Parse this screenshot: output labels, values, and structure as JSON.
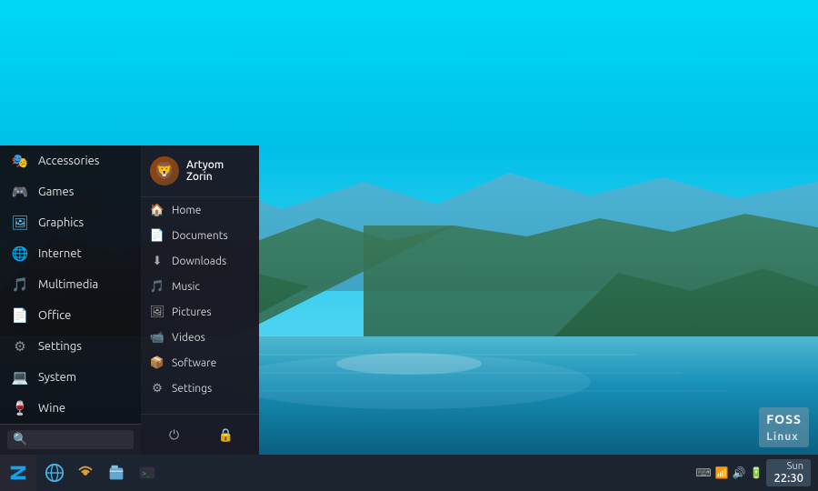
{
  "desktop": {
    "background_colors": [
      "#00d4f0",
      "#0090c0",
      "#1a6890"
    ]
  },
  "taskbar": {
    "clock": {
      "time": "22:30",
      "date": "Sun"
    },
    "icons": [
      {
        "name": "zorin-start",
        "label": "Start"
      },
      {
        "name": "browser-icon",
        "label": "Browser"
      },
      {
        "name": "network-icon",
        "label": "Network"
      },
      {
        "name": "files-icon",
        "label": "Files"
      },
      {
        "name": "terminal-icon",
        "label": "Terminal"
      }
    ],
    "tray": [
      "keyboard-icon",
      "network-tray-icon",
      "volume-icon",
      "battery-icon"
    ]
  },
  "start_menu": {
    "left_panel": {
      "items": [
        {
          "id": "accessories",
          "label": "Accessories",
          "icon": "🎭"
        },
        {
          "id": "games",
          "label": "Games",
          "icon": "🎮"
        },
        {
          "id": "graphics",
          "label": "Graphics",
          "icon": "🖼"
        },
        {
          "id": "internet",
          "label": "Internet",
          "icon": "🌐"
        },
        {
          "id": "multimedia",
          "label": "Multimedia",
          "icon": "🎵"
        },
        {
          "id": "office",
          "label": "Office",
          "icon": "📄"
        },
        {
          "id": "settings",
          "label": "Settings",
          "icon": "⚙"
        },
        {
          "id": "system",
          "label": "System",
          "icon": "💻"
        },
        {
          "id": "wine",
          "label": "Wine",
          "icon": "🍷"
        }
      ],
      "search_placeholder": ""
    },
    "right_panel": {
      "user": {
        "name": "Artyom Zorin",
        "avatar": "🦁"
      },
      "items": [
        {
          "id": "home",
          "label": "Home",
          "icon": "🏠"
        },
        {
          "id": "documents",
          "label": "Documents",
          "icon": "📄"
        },
        {
          "id": "downloads",
          "label": "Downloads",
          "icon": "⬇"
        },
        {
          "id": "music",
          "label": "Music",
          "icon": "🎵"
        },
        {
          "id": "pictures",
          "label": "Pictures",
          "icon": "🖼"
        },
        {
          "id": "videos",
          "label": "Videos",
          "icon": "📹"
        },
        {
          "id": "software",
          "label": "Software",
          "icon": "📦"
        },
        {
          "id": "settings",
          "label": "Settings",
          "icon": "⚙"
        }
      ],
      "actions": [
        {
          "id": "power",
          "label": "Power",
          "icon": "⏻"
        },
        {
          "id": "lock",
          "label": "Lock",
          "icon": "🔒"
        }
      ]
    }
  }
}
